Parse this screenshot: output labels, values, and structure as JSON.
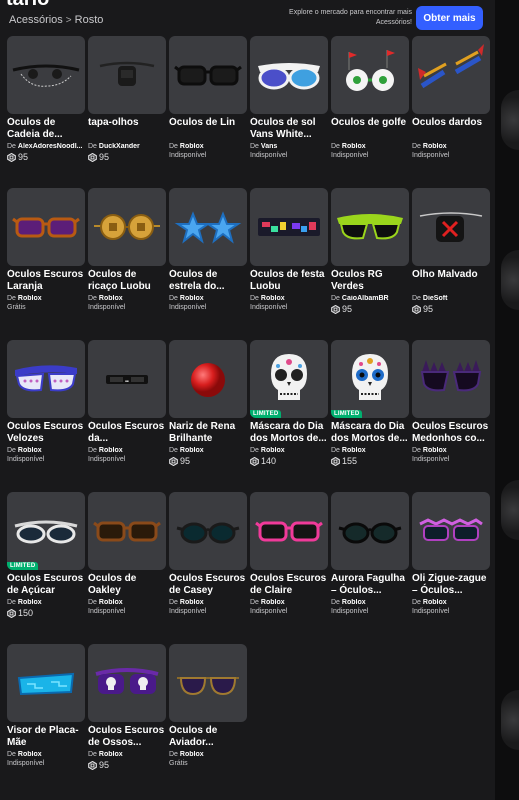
{
  "header": {
    "title": "tário",
    "breadcrumb": {
      "parent": "Acessórios",
      "separator": ">",
      "current": "Rosto"
    },
    "explore_text": "Explore o mercado para encontrar mais Acessórios!",
    "get_more_label": "Obter mais"
  },
  "colors": {
    "accent": "#335fff",
    "limited": "#00b06f",
    "card_bg": "#3b3c40",
    "page_bg": "#19191b"
  },
  "labels": {
    "by": "De"
  },
  "items": [
    {
      "name": "Óculos de Cadeia de...",
      "creator": "AlexAdoresNoodl...",
      "price": "95",
      "price_type": "robux",
      "icon": "chain-glasses-icon",
      "limited": ""
    },
    {
      "name": "tapa-olhos",
      "creator": "DuckXander",
      "price": "95",
      "price_type": "robux",
      "icon": "eyepatch-icon",
      "limited": ""
    },
    {
      "name": "Óculos de Lin",
      "creator": "Roblox",
      "price": "Indisponível",
      "price_type": "unavailable",
      "icon": "black-glasses-icon",
      "limited": ""
    },
    {
      "name": "Óculos de sol Vans White...",
      "creator": "Vans",
      "price": "Indisponível",
      "price_type": "unavailable",
      "icon": "vans-sunglasses-icon",
      "limited": ""
    },
    {
      "name": "Óculos de golfe",
      "creator": "Roblox",
      "price": "Indisponível",
      "price_type": "unavailable",
      "icon": "golf-glasses-icon",
      "limited": ""
    },
    {
      "name": "Óculos dardos",
      "creator": "Roblox",
      "price": "Indisponível",
      "price_type": "unavailable",
      "icon": "dart-glasses-icon",
      "limited": ""
    },
    {
      "name": "Óculos Escuros Laranja",
      "creator": "Roblox",
      "price": "Grátis",
      "price_type": "free",
      "icon": "orange-sunglasses-icon",
      "limited": ""
    },
    {
      "name": "Óculos de ricaço Luobu",
      "creator": "Roblox",
      "price": "Indisponível",
      "price_type": "unavailable",
      "icon": "coin-glasses-icon",
      "limited": ""
    },
    {
      "name": "Óculos de estrela do...",
      "creator": "Roblox",
      "price": "Indisponível",
      "price_type": "unavailable",
      "icon": "star-glasses-icon",
      "limited": ""
    },
    {
      "name": "Óculos de festa Luobu",
      "creator": "Roblox",
      "price": "Indisponível",
      "price_type": "unavailable",
      "icon": "party-glasses-icon",
      "limited": ""
    },
    {
      "name": "Óculos RG Verdes",
      "creator": "CaioAlbamBR",
      "price": "95",
      "price_type": "robux",
      "icon": "green-glasses-icon",
      "limited": ""
    },
    {
      "name": "Olho Malvado",
      "creator": "DieSoft",
      "price": "95",
      "price_type": "robux",
      "icon": "evil-eyepatch-icon",
      "limited": ""
    },
    {
      "name": "Óculos Escuros Velozes",
      "creator": "Roblox",
      "price": "Indisponível",
      "price_type": "unavailable",
      "icon": "fast-sunglasses-icon",
      "limited": ""
    },
    {
      "name": "Óculos Escuros da...",
      "creator": "Roblox",
      "price": "Indisponível",
      "price_type": "unavailable",
      "icon": "small-sunglasses-icon",
      "limited": ""
    },
    {
      "name": "Nariz de Rena Brilhante",
      "creator": "Roblox",
      "price": "95",
      "price_type": "robux",
      "icon": "red-nose-icon",
      "limited": ""
    },
    {
      "name": "Máscara do Dia dos Mortos de...",
      "creator": "Roblox",
      "price": "140",
      "price_type": "robux",
      "icon": "skull-mask-icon",
      "limited": "LIMITED"
    },
    {
      "name": "Máscara do Dia dos Mortos de...",
      "creator": "Roblox",
      "price": "155",
      "price_type": "robux",
      "icon": "skull-mask-blue-icon",
      "limited": "LIMITED"
    },
    {
      "name": "Óculos Escuros Medonhos co...",
      "creator": "Roblox",
      "price": "Indisponível",
      "price_type": "unavailable",
      "icon": "spiky-glasses-icon",
      "limited": ""
    },
    {
      "name": "Óculos Escuros de Açúcar",
      "creator": "Roblox",
      "price": "150",
      "price_type": "robux",
      "icon": "sugar-sunglasses-icon",
      "limited": "LIMITED"
    },
    {
      "name": "Óculos de Oakley",
      "creator": "Roblox",
      "price": "Indisponível",
      "price_type": "unavailable",
      "icon": "oakley-glasses-icon",
      "limited": ""
    },
    {
      "name": "Óculos Escuros de Casey",
      "creator": "Roblox",
      "price": "Indisponível",
      "price_type": "unavailable",
      "icon": "casey-sunglasses-icon",
      "limited": ""
    },
    {
      "name": "Óculos Escuros de Claire",
      "creator": "Roblox",
      "price": "Indisponível",
      "price_type": "unavailable",
      "icon": "pink-sunglasses-icon",
      "limited": ""
    },
    {
      "name": "Aurora Fagulha – Óculos...",
      "creator": "Roblox",
      "price": "Indisponível",
      "price_type": "unavailable",
      "icon": "round-dark-glasses-icon",
      "limited": ""
    },
    {
      "name": "Oli Zigue-zague – Óculos...",
      "creator": "Roblox",
      "price": "Indisponível",
      "price_type": "unavailable",
      "icon": "zigzag-glasses-icon",
      "limited": ""
    },
    {
      "name": "Visor de Placa-Mãe",
      "creator": "Roblox",
      "price": "Indisponível",
      "price_type": "unavailable",
      "icon": "visor-icon",
      "limited": ""
    },
    {
      "name": "Óculos Escuros de Ossos...",
      "creator": "Roblox",
      "price": "95",
      "price_type": "robux",
      "icon": "bones-sunglasses-icon",
      "limited": ""
    },
    {
      "name": "Óculos de Aviador...",
      "creator": "Roblox",
      "price": "Grátis",
      "price_type": "free",
      "icon": "aviator-glasses-icon",
      "limited": ""
    }
  ]
}
